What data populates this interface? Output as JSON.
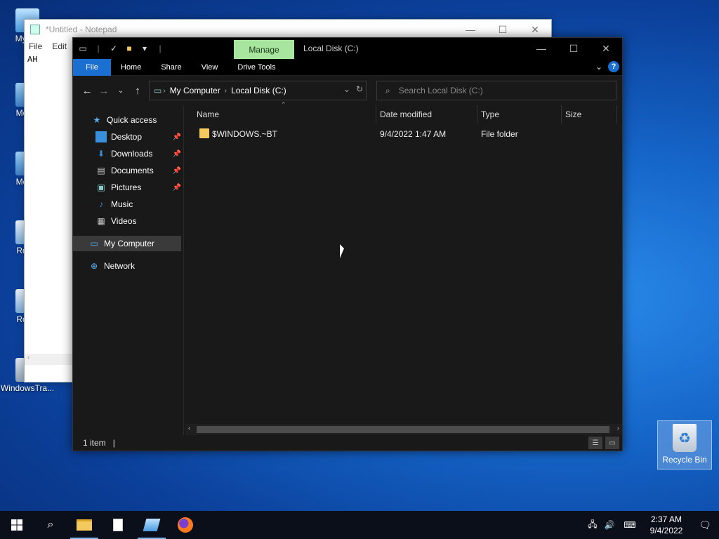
{
  "desktop": {
    "icons": [
      {
        "label": "My Co",
        "name": "desktop-icon-my-computer"
      },
      {
        "label": "Media",
        "name": "desktop-icon-media-1"
      },
      {
        "label": "Media",
        "name": "desktop-icon-media-2"
      },
      {
        "label": "Roblo",
        "name": "desktop-icon-roblox-1"
      },
      {
        "label": "Roblo",
        "name": "desktop-icon-roblox-2"
      },
      {
        "label": "WindowsTra...",
        "name": "desktop-icon-windows-tra"
      }
    ],
    "recycle_bin": "Recycle Bin"
  },
  "notepad": {
    "title": "*Untitled - Notepad",
    "menu": [
      "File",
      "Edit"
    ],
    "text": "AH"
  },
  "explorer": {
    "context_tab": "Manage",
    "title": "Local Disk (C:)",
    "ribbon_tabs": [
      "File",
      "Home",
      "Share",
      "View",
      "Drive Tools"
    ],
    "address": {
      "crumbs": [
        "My Computer",
        "Local Disk (C:)"
      ]
    },
    "search_placeholder": "Search Local Disk (C:)",
    "nav": {
      "quick_access": "Quick access",
      "items": [
        "Desktop",
        "Downloads",
        "Documents",
        "Pictures",
        "Music",
        "Videos"
      ],
      "my_computer": "My Computer",
      "network": "Network"
    },
    "columns": [
      "Name",
      "Date modified",
      "Type",
      "Size"
    ],
    "rows": [
      {
        "name": "$WINDOWS.~BT",
        "date": "9/4/2022 1:47 AM",
        "type": "File folder",
        "size": ""
      }
    ],
    "status": "1 item"
  },
  "taskbar": {
    "time": "2:37 AM",
    "date": "9/4/2022"
  },
  "colors": {
    "accent": "#1a6fd0",
    "manage_tab": "#a8e6a0",
    "folder": "#f4c95d"
  }
}
